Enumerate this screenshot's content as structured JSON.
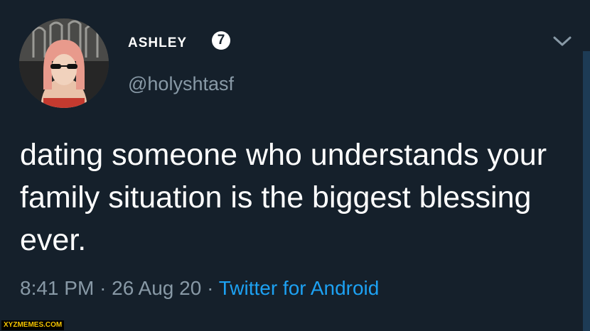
{
  "tweet": {
    "display_name": "ashley",
    "emoji": "7",
    "handle": "@holyshtasf",
    "text": "dating someone who understands your family situation is the biggest blessing ever.",
    "time": "8:41 PM",
    "date": "26 Aug 20",
    "separator": "·",
    "source": "Twitter for Android"
  },
  "watermark": "XYZMEMES.COM",
  "colors": {
    "background": "#15202b",
    "text": "#ffffff",
    "secondary_text": "#8899a6",
    "link": "#1da1f2"
  },
  "icons": {
    "menu": "chevron-down-icon",
    "badge": "emoji-seven-icon"
  }
}
